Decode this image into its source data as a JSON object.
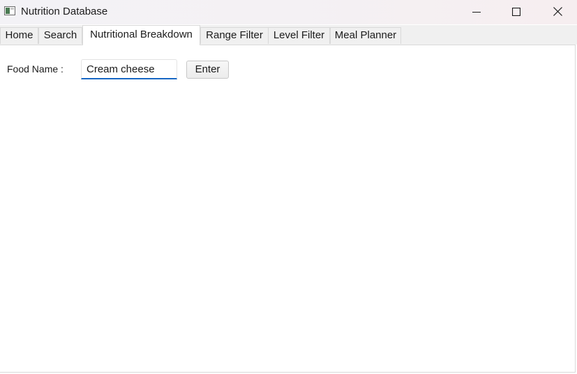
{
  "window": {
    "title": "Nutrition Database"
  },
  "icons": {
    "app": "app-window-icon",
    "minimize": "minimize-icon",
    "maximize": "maximize-icon",
    "close": "close-icon"
  },
  "tabs": [
    {
      "label": "Home",
      "active": false
    },
    {
      "label": "Search",
      "active": false
    },
    {
      "label": "Nutritional Breakdown",
      "active": true
    },
    {
      "label": "Range Filter",
      "active": false
    },
    {
      "label": "Level Filter",
      "active": false
    },
    {
      "label": "Meal Planner",
      "active": false
    }
  ],
  "form": {
    "food_label": "Food Name :",
    "food_value": "Cream cheese",
    "enter_label": "Enter"
  },
  "colors": {
    "input_focus": "#1767c4"
  }
}
